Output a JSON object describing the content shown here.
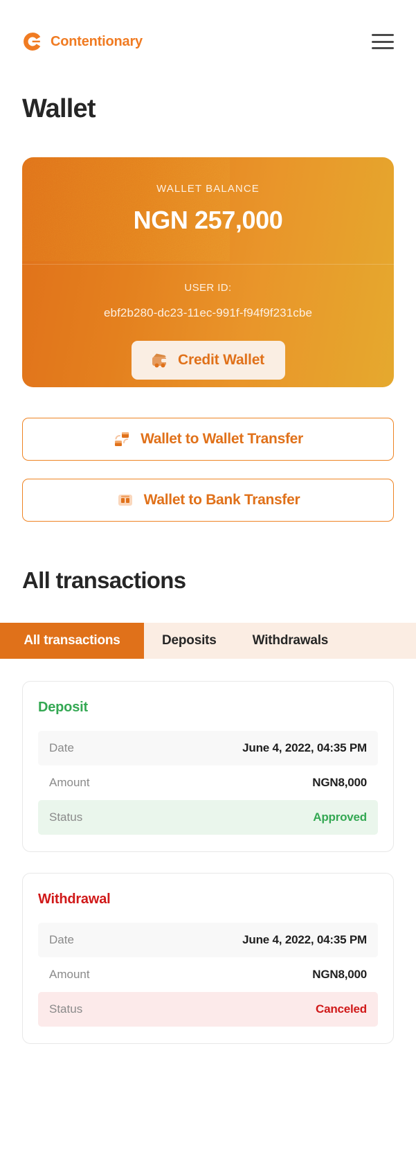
{
  "brand": {
    "name": "Contentionary",
    "logo_icon": "contentionary-c-logo",
    "accent_color": "#E0711A"
  },
  "header": {
    "menu_icon": "hamburger-menu-icon"
  },
  "page": {
    "title": "Wallet"
  },
  "balance_card": {
    "balance_label": "WALLET BALANCE",
    "balance_amount": "NGN 257,000",
    "user_id_label": "USER ID:",
    "user_id_value": "ebf2b280-dc23-11ec-991f-f94f9f231cbe",
    "credit_button_label": "Credit Wallet",
    "credit_button_icon": "wallet-cash-icon",
    "gradient_from": "#E0711A",
    "gradient_to": "#E5A92E"
  },
  "actions": [
    {
      "label": "Wallet to Wallet Transfer",
      "icon": "wallet-transfer-icon"
    },
    {
      "label": "Wallet to Bank Transfer",
      "icon": "bank-transfer-icon"
    }
  ],
  "transactions_section": {
    "heading": "All transactions",
    "tabs": [
      {
        "label": "All transactions",
        "active": true
      },
      {
        "label": "Deposits",
        "active": false
      },
      {
        "label": "Withdrawals",
        "active": false
      }
    ],
    "row_labels": {
      "date": "Date",
      "amount": "Amount",
      "status": "Status"
    },
    "items": [
      {
        "type": "Deposit",
        "type_kind": "deposit",
        "date": "June 4, 2022, 04:35 PM",
        "amount": "NGN8,000",
        "status": "Approved",
        "status_kind": "approved"
      },
      {
        "type": "Withdrawal",
        "type_kind": "withdrawal",
        "date": "June 4, 2022, 04:35 PM",
        "amount": "NGN8,000",
        "status": "Canceled",
        "status_kind": "canceled"
      }
    ]
  },
  "colors": {
    "success": "#34A853",
    "danger": "#D01919",
    "accent": "#E0711A",
    "tabbar_bg": "#FBEDE3"
  }
}
